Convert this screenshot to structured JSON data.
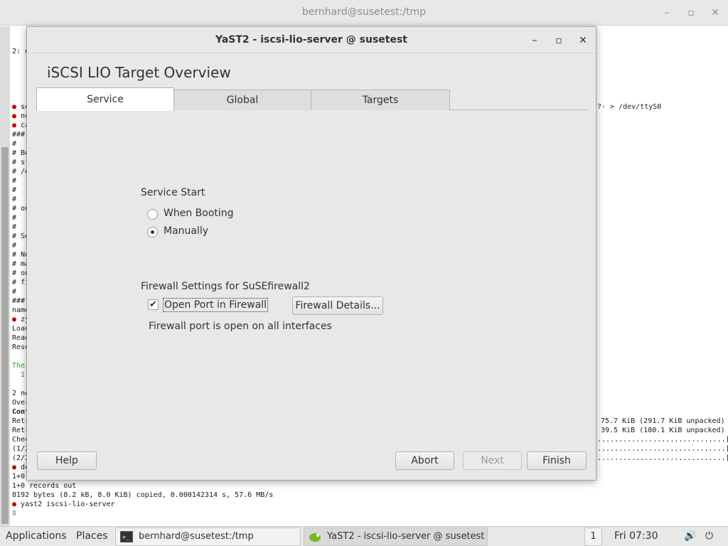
{
  "terminal": {
    "title": "bernhard@susetest:/tmp",
    "left_column": [
      "2: e",
      "",
      "",
      "",
      "",
      "",
      "",
      "",
      "",
      " se",
      " ne",
      " ca",
      "###",
      "#",
      "# Be",
      "# st",
      "# /e",
      "#",
      "#",
      "#",
      "# on",
      "#",
      "#",
      "# Se",
      "#",
      "# Ne",
      "# ma",
      "# on",
      "# fi",
      "#",
      "###",
      "name",
      " zy",
      "Load",
      "Read",
      "Reso",
      "",
      "The",
      "  1:",
      "",
      "",
      "2 ne",
      "Over",
      "Cont",
      "Retr",
      "Retr",
      "Chec",
      "(1/2",
      "(2/2",
      " do",
      "1+0",
      "1+0 records out",
      "8192 bytes (8.2 kB, 8.0 KiB) copied, 0.000142314 s, 57.6 MB/s",
      " yast2 iscsi-lio-server",
      ""
    ],
    "right_fragments": {
      "ttys0": "?- > /dev/ttyS0",
      "retr1": "75.7 KiB (291.7 KiB unpacked)",
      "retr2": "39.5 KiB (180.1 KiB unpacked)",
      "check": "..............................[done]",
      "inst1": "..............................[done]",
      "inst2": "..............................[done]"
    }
  },
  "dialog": {
    "title": "YaST2 - iscsi-lio-server @ susetest",
    "heading": "iSCSI LIO Target Overview",
    "tabs": [
      "Service",
      "Global",
      "Targets"
    ],
    "service_start": {
      "label": "Service Start",
      "options": [
        "When Booting",
        "Manually"
      ],
      "selected": "Manually"
    },
    "firewall": {
      "label": "Firewall Settings for SuSEfirewall2",
      "checkbox_label": "Open Port in Firewall",
      "checked": true,
      "details_button": "Firewall Details...",
      "status": "Firewall port is open on all interfaces"
    },
    "buttons": {
      "help": "Help",
      "abort": "Abort",
      "next": "Next",
      "finish": "Finish"
    }
  },
  "panel": {
    "applications": "Applications",
    "places": "Places",
    "tasks": [
      "bernhard@susetest:/tmp",
      "YaST2 - iscsi-lio-server @ susetest"
    ],
    "workspace": "1",
    "clock": "Fri 07:30"
  },
  "icons": [
    "minimize-icon",
    "maximize-icon",
    "close-icon",
    "terminal-icon",
    "yast-icon",
    "volume-icon",
    "power-icon"
  ]
}
